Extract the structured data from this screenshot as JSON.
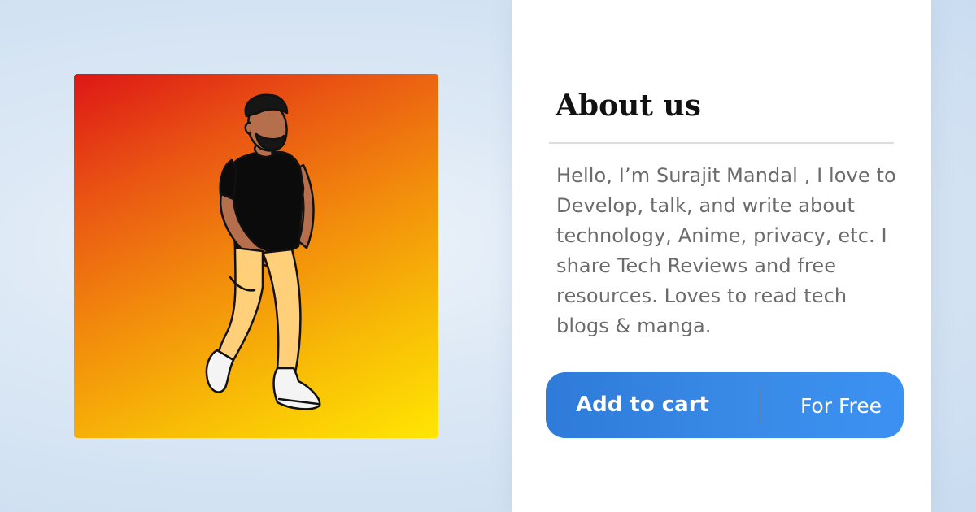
{
  "profile_image": {
    "subject": "illustrated man walking",
    "gradient_colors": [
      "#dd1616",
      "#f28b0c",
      "#ffe602"
    ]
  },
  "about": {
    "title": "About us",
    "description": "Hello, I’m Surajit Mandal   , I love to Develop, talk, and write about technology, Anime, privacy, etc. I share Tech Reviews and free resources. Loves to read tech blogs & manga."
  },
  "cart_button": {
    "label": "Add to cart",
    "price": "For Free",
    "accent_color": "#3a8be8"
  }
}
